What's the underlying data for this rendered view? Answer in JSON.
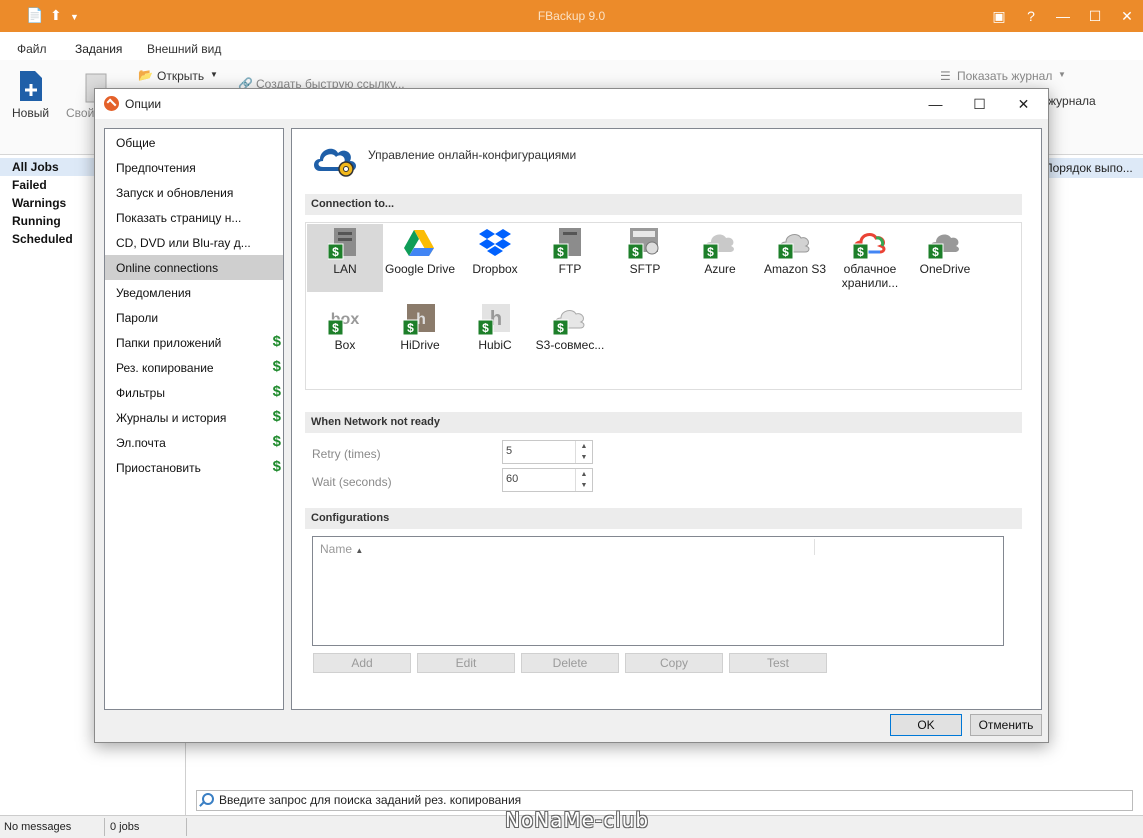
{
  "app": {
    "title": "FBackup 9.0"
  },
  "ribbon": {
    "tabs": [
      "Файл",
      "Задания",
      "Внешний вид"
    ],
    "new_label": "Новый",
    "props_label": "Свой",
    "open_label": "Открыть",
    "quicklink_label": "Создать быструю ссылку...",
    "show_log_label": "Показать журнал",
    "log_label": "журнала"
  },
  "left_panel": {
    "items": [
      "All Jobs",
      "Failed",
      "Warnings",
      "Running",
      "Scheduled"
    ]
  },
  "jobs_header": {
    "col_label": "Порядок выпо..."
  },
  "search": {
    "placeholder": "Введите запрос для поиска заданий рез. копирования"
  },
  "status": {
    "messages": "No messages",
    "jobs": "0 jobs"
  },
  "watermark": "NoNaMe-club",
  "dialog": {
    "title": "Опции",
    "header": "Управление онлайн-конфигурациями",
    "nav": [
      {
        "label": "Общие",
        "paid": false
      },
      {
        "label": "Предпочтения",
        "paid": false
      },
      {
        "label": "Запуск и обновления",
        "paid": false
      },
      {
        "label": "Показать страницу н...",
        "paid": false
      },
      {
        "label": "CD, DVD или Blu-ray д...",
        "paid": false
      },
      {
        "label": "Online connections",
        "paid": false
      },
      {
        "label": "Уведомления",
        "paid": false
      },
      {
        "label": "Пароли",
        "paid": false
      },
      {
        "label": "Папки приложений",
        "paid": true
      },
      {
        "label": "Рез. копирование",
        "paid": true
      },
      {
        "label": "Фильтры",
        "paid": true
      },
      {
        "label": "Журналы и история",
        "paid": true
      },
      {
        "label": "Эл.почта",
        "paid": true
      },
      {
        "label": "Приостановить",
        "paid": true
      }
    ],
    "selected_nav": "Online connections",
    "paid_symbol": "$",
    "sections": {
      "connection": "Connection to...",
      "network": "When Network not ready",
      "configs": "Configurations"
    },
    "connections": [
      {
        "label": "LAN",
        "icon": "lan-icon"
      },
      {
        "label": "Google Drive",
        "icon": "google-drive-icon"
      },
      {
        "label": "Dropbox",
        "icon": "dropbox-icon"
      },
      {
        "label": "FTP",
        "icon": "ftp-icon"
      },
      {
        "label": "SFTP",
        "icon": "sftp-icon"
      },
      {
        "label": "Azure",
        "icon": "azure-icon"
      },
      {
        "label": "Amazon S3",
        "icon": "amazon-s3-icon"
      },
      {
        "label": "облачное хранили...",
        "icon": "google-cloud-icon"
      },
      {
        "label": "OneDrive",
        "icon": "onedrive-icon"
      },
      {
        "label": "Box",
        "icon": "box-icon"
      },
      {
        "label": "HiDrive",
        "icon": "hidrive-icon"
      },
      {
        "label": "HubiC",
        "icon": "hubic-icon"
      },
      {
        "label": "S3-совмес...",
        "icon": "s3-compatible-icon"
      }
    ],
    "network": {
      "retry_label": "Retry (times)",
      "retry_value": "5",
      "wait_label": "Wait (seconds)",
      "wait_value": "60"
    },
    "configs": {
      "column": "Name",
      "buttons": [
        "Add",
        "Edit",
        "Delete",
        "Copy",
        "Test"
      ]
    },
    "ok": "OK",
    "cancel": "Отменить"
  }
}
